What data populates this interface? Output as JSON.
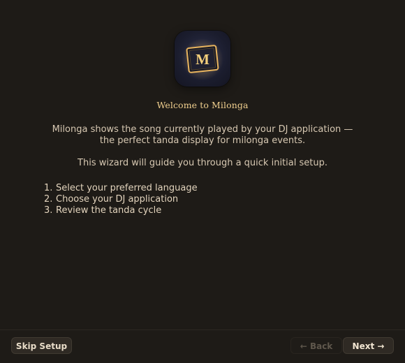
{
  "welcome": {
    "title": "Welcome to Milonga",
    "line1": "Milonga shows the song currently played by your DJ application —",
    "line2": "the perfect tanda display for milonga events.",
    "guide": "This wizard will guide you through a quick initial setup."
  },
  "logo": {
    "letter": "M",
    "icon": "milonga-app-icon"
  },
  "steps": [
    {
      "num": "1.",
      "label": "Select your preferred language"
    },
    {
      "num": "2.",
      "label": "Choose your DJ application"
    },
    {
      "num": "3.",
      "label": "Review the tanda cycle"
    }
  ],
  "footer": {
    "skip_label": "Skip Setup",
    "back_arrow": "←",
    "back_label": "Back",
    "next_label": "Next",
    "next_arrow": "→"
  },
  "colors": {
    "background": "#1e1b17",
    "title": "#f0cf8e",
    "text": "#d7c8b2",
    "button": "#2f2a24",
    "disabled_text": "#5f574c"
  }
}
